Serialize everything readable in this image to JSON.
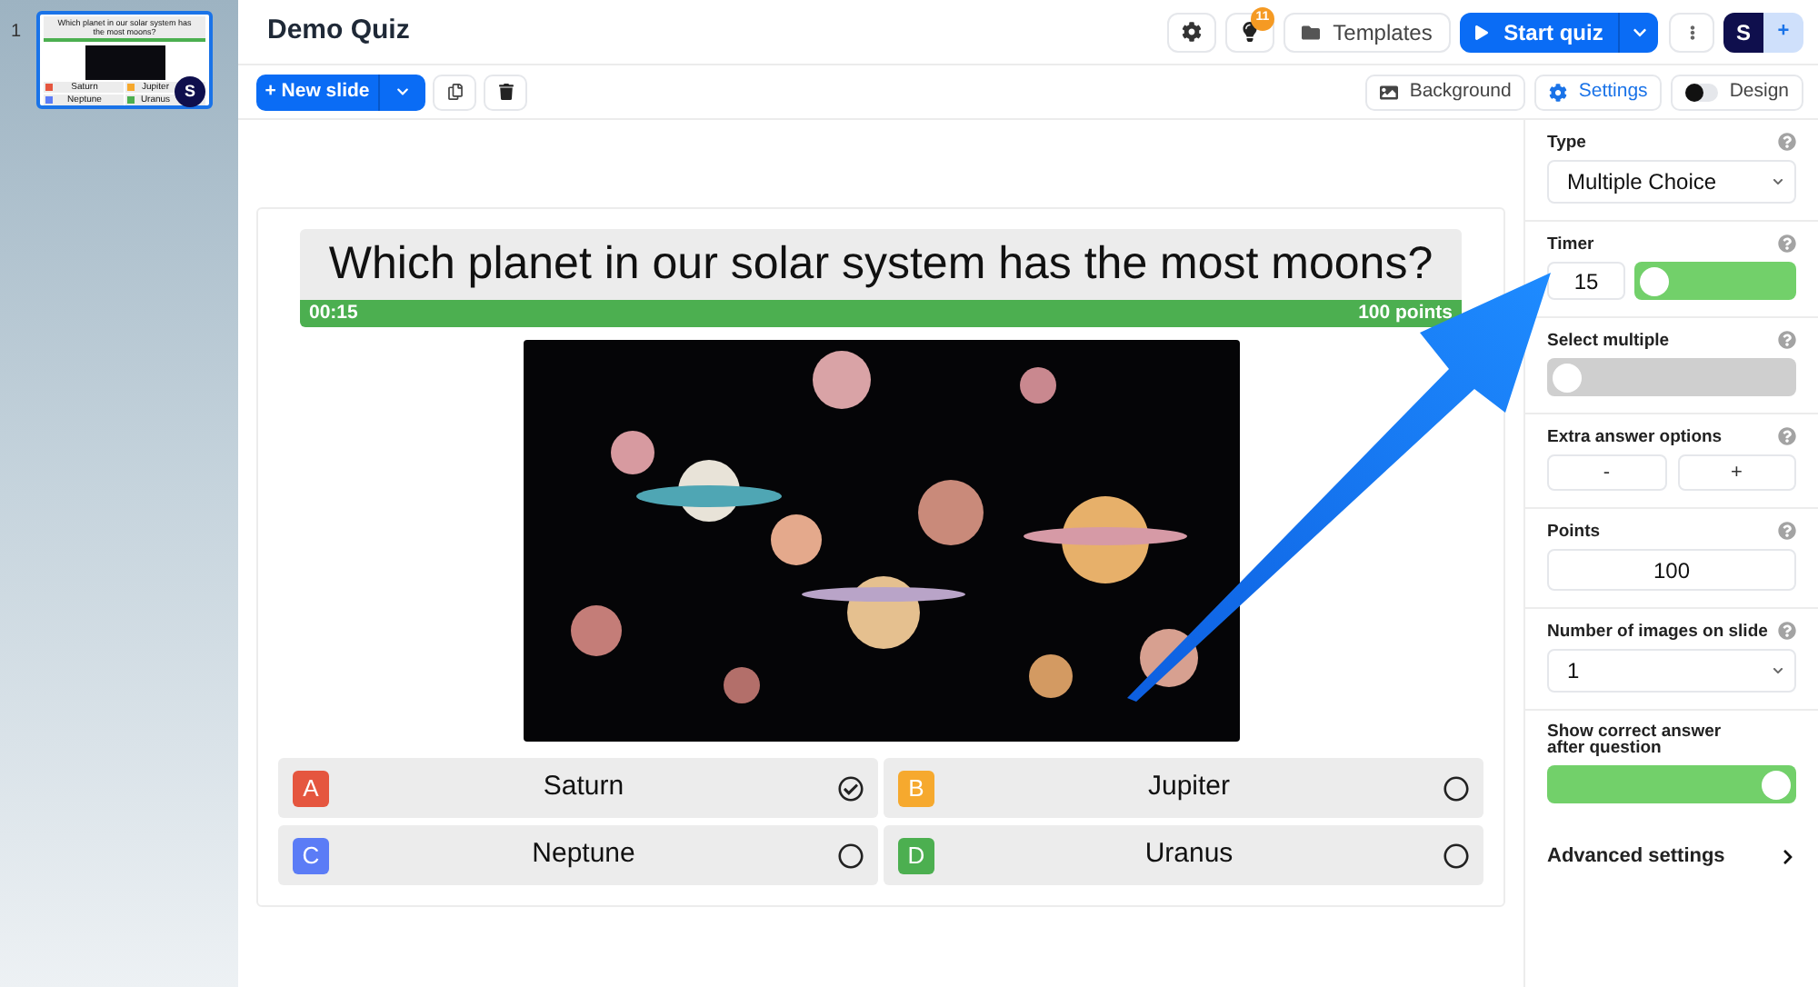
{
  "slides_panel": {
    "slides": [
      {
        "number": "1",
        "selected": true,
        "question": "Which planet in our solar system has the most moons?",
        "answers": [
          {
            "text": "Saturn",
            "color": "#e5563f"
          },
          {
            "text": "Jupiter",
            "color": "#f6a92e"
          },
          {
            "text": "Neptune",
            "color": "#5b7cf6"
          },
          {
            "text": "Uranus",
            "color": "#4caf50"
          }
        ],
        "avatar": "S"
      }
    ]
  },
  "header": {
    "title": "Demo Quiz",
    "notification_count": "11",
    "templates_button": "Templates",
    "start_button": "Start quiz",
    "avatar": "S",
    "add_button": "+"
  },
  "toolbar": {
    "new_slide_button": "+ New slide",
    "view_buttons": [
      {
        "kind": "image",
        "label": "Background",
        "selected": false
      },
      {
        "kind": "settings",
        "label": "Settings",
        "selected": true
      },
      {
        "kind": "toggle",
        "label": "Design",
        "selected": false
      }
    ]
  },
  "slide": {
    "question": "Which planet in our solar system has the most moons?",
    "timer": "00:15",
    "points": "100 points",
    "answers": [
      {
        "letter": "A",
        "text": "Saturn",
        "color": "#e5563f",
        "correct": true
      },
      {
        "letter": "B",
        "text": "Jupiter",
        "color": "#f6a92e",
        "correct": false
      },
      {
        "letter": "C",
        "text": "Neptune",
        "color": "#5b7cf6",
        "correct": false
      },
      {
        "letter": "D",
        "text": "Uranus",
        "color": "#4caf50",
        "correct": false
      }
    ]
  },
  "settings_panel": {
    "fields": [
      {
        "kind": "select",
        "label": "Type",
        "help": true,
        "value": "Multiple Choice"
      },
      {
        "kind": "timer",
        "label": "Timer",
        "help": true,
        "value": "15",
        "on": true,
        "knob_right": false
      },
      {
        "kind": "toggle",
        "label": "Select multiple",
        "help": true,
        "on": false,
        "knob_right": false
      },
      {
        "kind": "stepper",
        "label": "Extra answer options",
        "help": true,
        "buttons": [
          "-",
          "+"
        ]
      },
      {
        "kind": "number",
        "label": "Points",
        "help": true,
        "value": "100"
      },
      {
        "kind": "select",
        "label": "Number of images on slide",
        "help": true,
        "value": "1"
      },
      {
        "kind": "toggle",
        "label": "Show correct answer after question",
        "help": false,
        "on": true,
        "knob_right": true
      }
    ],
    "advanced_settings": "Advanced settings"
  }
}
